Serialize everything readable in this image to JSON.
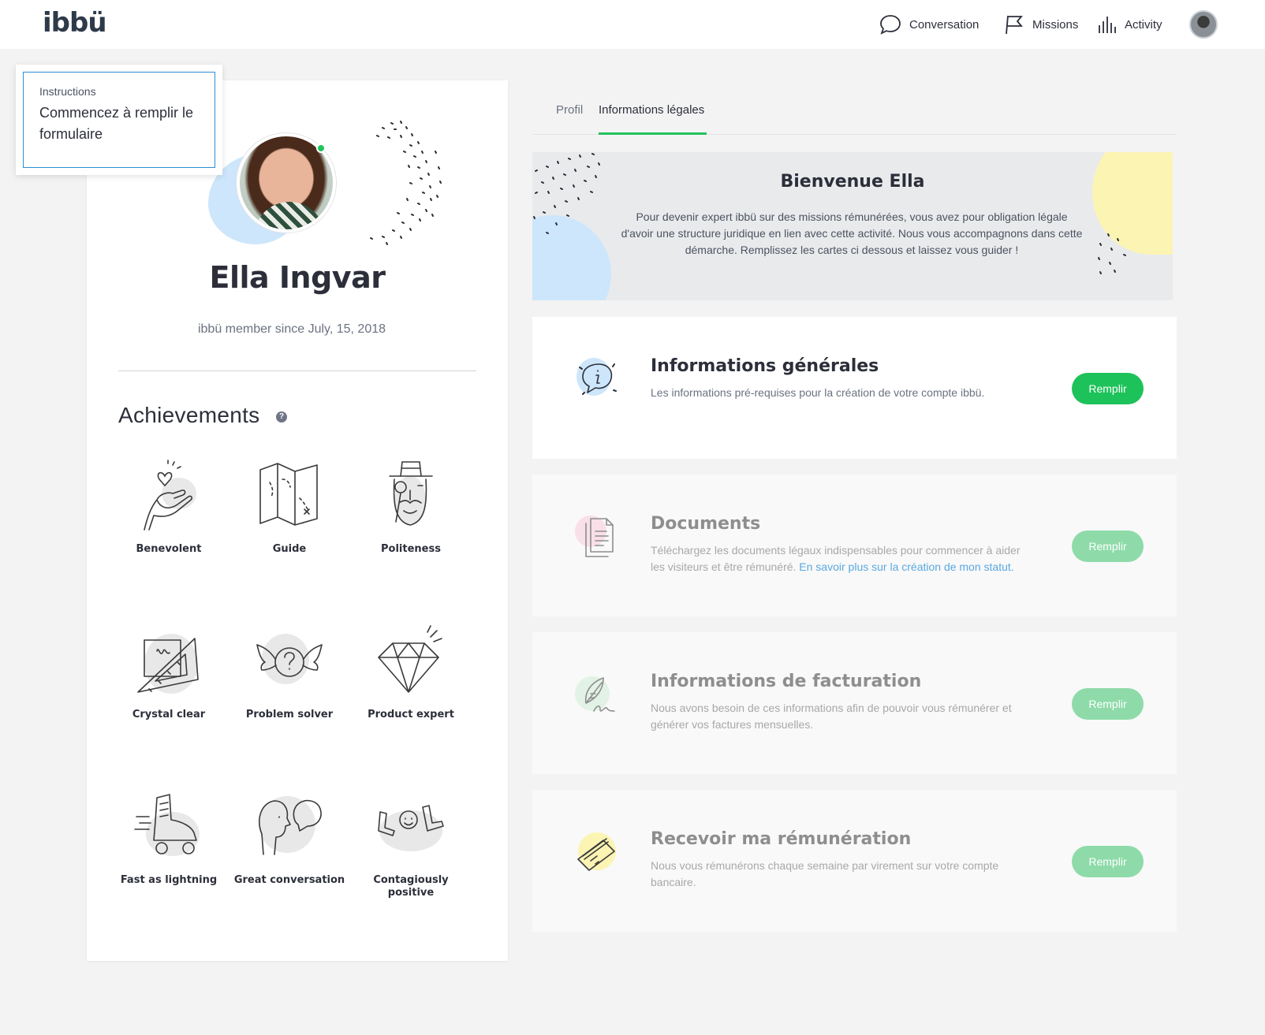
{
  "header": {
    "logo": "ibbü",
    "nav": [
      {
        "label": "Conversation",
        "icon": "chat-bubble-icon"
      },
      {
        "label": "Missions",
        "icon": "flag-icon"
      },
      {
        "label": "Activity",
        "icon": "bar-chart-icon"
      }
    ]
  },
  "instructions": {
    "label": "Instructions",
    "text": "Commencez à remplir le formulaire"
  },
  "profile": {
    "name": "Ella Ingvar",
    "member_since": "ibbü member since July, 15, 2018",
    "achievements_title": "Achievements",
    "achievements_help": "?",
    "achievements": [
      {
        "label": "Benevolent",
        "icon": "heart-hand-icon"
      },
      {
        "label": "Guide",
        "icon": "map-icon"
      },
      {
        "label": "Politeness",
        "icon": "gentleman-icon"
      },
      {
        "label": "Crystal clear",
        "icon": "ruler-triangle-icon"
      },
      {
        "label": "Problem solver",
        "icon": "winged-question-icon"
      },
      {
        "label": "Product expert",
        "icon": "diamond-icon"
      },
      {
        "label": "Fast as lightning",
        "icon": "roller-skate-icon"
      },
      {
        "label": "Great conversation",
        "icon": "speech-head-icon"
      },
      {
        "label": "Contagiously positive",
        "icon": "lol-icon"
      }
    ]
  },
  "tabs": [
    {
      "label": "Profil",
      "active": false
    },
    {
      "label": "Informations légales",
      "active": true
    }
  ],
  "welcome": {
    "title": "Bienvenue Ella",
    "text": "Pour devenir expert ibbü sur des missions rémunérées, vous avez pour obligation légale d'avoir une structure juridique en lien avec cette activité. Nous vous accompagnons dans cette démarche. Remplissez les cartes ci dessous et laissez vous guider !"
  },
  "sections": [
    {
      "title": "Informations générales",
      "description": "Les informations pré-requises pour la création de votre compte ibbü.",
      "link": "",
      "button": "Remplir",
      "icon": "info-bubble-icon",
      "enabled": true
    },
    {
      "title": "Documents",
      "description": "Téléchargez les documents légaux indispensables pour commencer à aider les visiteurs et être rémunéré. ",
      "link": "En savoir plus sur la création de mon statut.",
      "button": "Remplir",
      "icon": "documents-icon",
      "enabled": false
    },
    {
      "title": "Informations de facturation",
      "description": "Nous avons besoin de ces informations afin de pouvoir vous rémunérer et générer vos factures mensuelles.",
      "link": "",
      "button": "Remplir",
      "icon": "feather-signature-icon",
      "enabled": false
    },
    {
      "title": "Recevoir ma rémunération",
      "description": "Nous vous rémunérons chaque semaine par virement sur votre compte bancaire.",
      "link": "",
      "button": "Remplir",
      "icon": "credit-card-icon",
      "enabled": false
    }
  ],
  "colors": {
    "accent": "#1ec25a",
    "accent_disabled": "#8edba9",
    "link": "#5aa8e0",
    "online": "#21c35a"
  }
}
